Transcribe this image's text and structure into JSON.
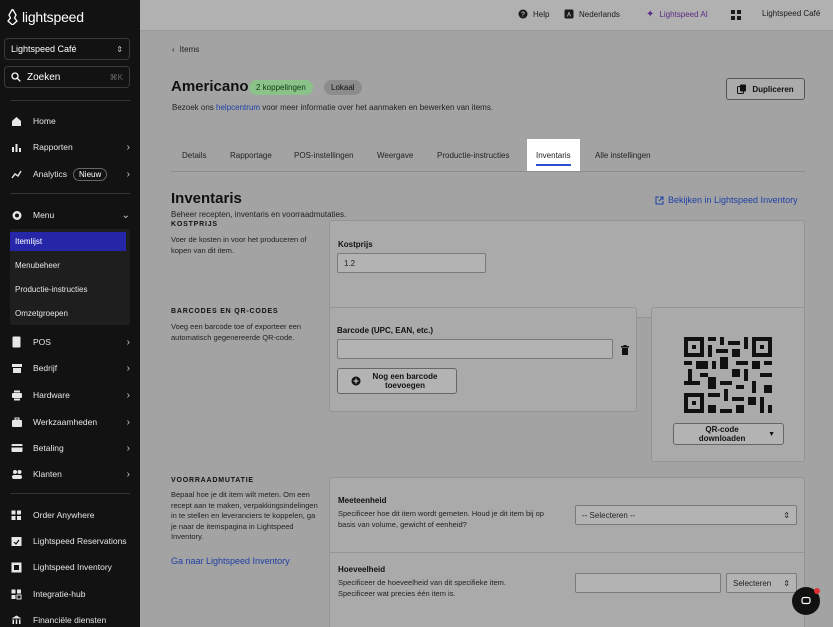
{
  "sidebar": {
    "brand": "lightspeed",
    "store": "Lightspeed Café",
    "search_placeholder": "Zoeken",
    "search_shortcut": "⌘K",
    "nav": [
      {
        "label": "Home"
      },
      {
        "label": "Rapporten"
      },
      {
        "label": "Analytics",
        "badge": "Nieuw"
      },
      {
        "label": "Menu"
      },
      {
        "label": "POS"
      },
      {
        "label": "Bedrijf"
      },
      {
        "label": "Hardware"
      },
      {
        "label": "Werkzaamheden"
      },
      {
        "label": "Betaling"
      },
      {
        "label": "Klanten"
      },
      {
        "label": "Order Anywhere"
      },
      {
        "label": "Lightspeed Reservations"
      },
      {
        "label": "Lightspeed Inventory"
      },
      {
        "label": "Integratie-hub"
      },
      {
        "label": "Financiële diensten"
      }
    ],
    "menu_sub": [
      {
        "label": "Itemlijst",
        "active": true
      },
      {
        "label": "Menubeheer"
      },
      {
        "label": "Productie-instructies"
      },
      {
        "label": "Omzetgroepen"
      }
    ]
  },
  "topbar": {
    "help": "Help",
    "language": "Nederlands",
    "ai": "Lightspeed AI",
    "account": "Lightspeed Café"
  },
  "main": {
    "breadcrumb": "Items",
    "title": "Americano",
    "pill_links": "2 koppelingen",
    "pill_local": "Lokaal",
    "subtitle_pre": "Bezoek ons ",
    "subtitle_link": "helpcentrum",
    "subtitle_post": " voor meer informatie over het aanmaken en bewerken van items.",
    "duplicate_button": "Dupliceren",
    "tabs": [
      {
        "label": "Details"
      },
      {
        "label": "Rapportage"
      },
      {
        "label": "POS-instellingen"
      },
      {
        "label": "Weergave"
      },
      {
        "label": "Productie-instructies"
      },
      {
        "label": "Inventaris",
        "active": true
      },
      {
        "label": "Alle instellingen"
      }
    ],
    "section_title": "Inventaris",
    "section_subtitle": "Beheer recepten, inventaris en voorraadmutaties.",
    "inventory_link": "Bekijken in Lightspeed Inventory",
    "cost": {
      "heading": "KOSTPRIJS",
      "description": "Voer de kosten in voor het produceren of kopen van dit item.",
      "label": "Kostprijs",
      "value": "1.2"
    },
    "barcodes": {
      "heading": "BARCODES EN QR-CODES",
      "description": "Voeg een barcode toe of exporteer een automatisch gegenereerde QR-code.",
      "label": "Barcode (UPC, EAN, etc.)",
      "value": "",
      "add_button": "Nog een barcode toevoegen",
      "qr_download": "QR-code downloaden"
    },
    "stock": {
      "heading": "VOORRAADMUTATIE",
      "description": "Bepaal hoe je dit item wilt meten. Om een recept aan te maken, verpakkingsindelingen in te stellen en leveranciers te koppelen, ga je naar de itemspagina in Lightspeed Inventory.",
      "link": "Ga naar Lightspeed Inventory",
      "unit_label": "Meeteenheid",
      "unit_desc": "Specificeer hoe dit item wordt gemeten. Houd je dit item bij op basis van volume, gewicht of eenheid?",
      "unit_select": "-- Selecteren --",
      "qty_label": "Hoeveelheid",
      "qty_desc": "Specificeer de hoeveelheid van dit specifieke item. Specificeer wat precies één item is.",
      "qty_value": "",
      "qty_select": "Selecteren"
    }
  }
}
